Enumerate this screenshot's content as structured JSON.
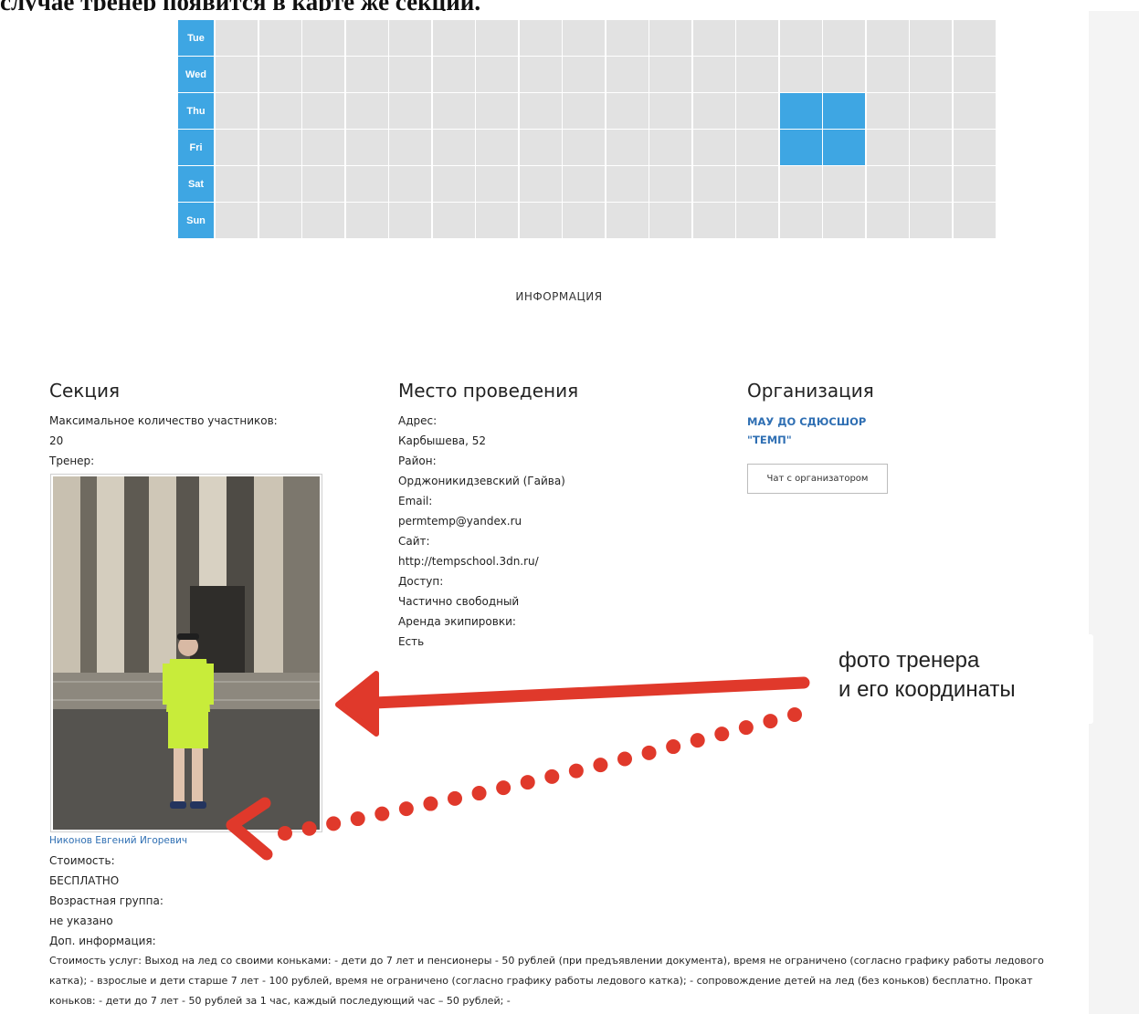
{
  "heading": "случае тренер появится в карте же секции.",
  "schedule": {
    "days": [
      "Tue",
      "Wed",
      "Thu",
      "Fri",
      "Sat",
      "Sun"
    ],
    "slots_per_day": 18,
    "active": [
      {
        "day": "Thu",
        "slots": [
          13,
          14
        ]
      },
      {
        "day": "Fri",
        "slots": [
          13,
          14
        ]
      }
    ],
    "colors": {
      "active": "#3ea6e3",
      "empty": "#e2e2e2"
    }
  },
  "info_title": "ИНФОРМАЦИЯ",
  "section": {
    "title": "Секция",
    "max_label": "Максимальное количество участников:",
    "max_value": "20",
    "coach_label": "Тренер:",
    "coach_name": "Никонов Евгений Игоревич",
    "cost_label": "Стоимость:",
    "cost_value": "БЕСПЛАТНО",
    "age_label": "Возрастная группа:",
    "age_value": "не указано",
    "extra_label": "Доп. информация:",
    "extra_value": "Стоимость услуг: Выход на лед со своими коньками: - дети до 7 лет и пенсионеры - 50 рублей (при предъявлении документа), время не ограничено (согласно графику работы ледового катка); - взрослые и дети старше 7 лет - 100 рублей, время не ограничено (согласно графику работы ледового катка); - сопровождение детей на лед (без коньков) бесплатно. Прокат коньков: - дети до 7 лет - 50 рублей за 1 час, каждый последующий час – 50 рублей; -"
  },
  "venue": {
    "title": "Место проведения",
    "address_label": "Адрес:",
    "address_value": "Карбышева, 52",
    "district_label": "Район:",
    "district_value": "Орджоникидзевский (Гайва)",
    "email_label": "Email:",
    "email_value": "permtemp@yandex.ru",
    "site_label": "Сайт:",
    "site_value": "http://tempschool.3dn.ru/",
    "access_label": "Доступ:",
    "access_value": "Частично свободный",
    "rental_label": "Аренда экипировки:",
    "rental_value": "Есть"
  },
  "organization": {
    "title": "Организация",
    "name_line1": "МАУ ДО СДЮСШОР",
    "name_line2": "\"ТЕМП\"",
    "chat_button": "Чат с организатором"
  },
  "annotation": {
    "line1": "фото тренера",
    "line2": "и его координаты",
    "arrow_color": "#e0392b"
  }
}
